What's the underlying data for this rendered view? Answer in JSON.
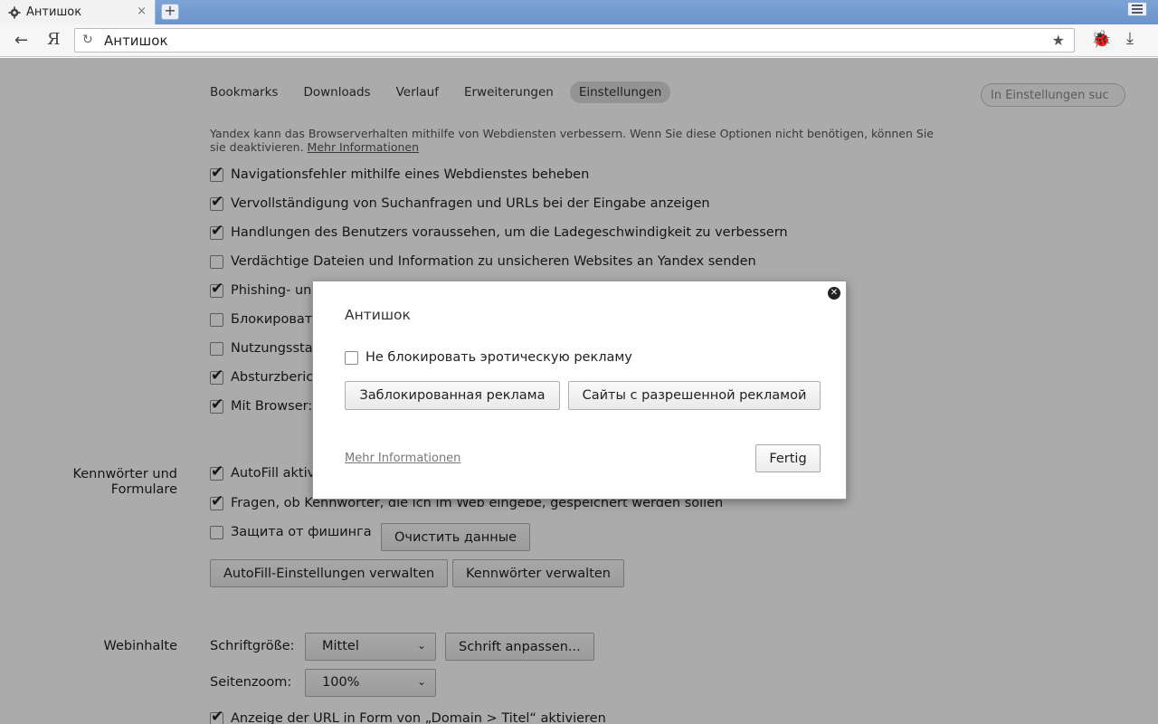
{
  "browser": {
    "tab_title": "Антишок",
    "tab_close": "×",
    "new_tab": "+",
    "back_icon": "←",
    "yandex_logo": "Я",
    "reload_icon": "↻",
    "address": "Антишок",
    "star_icon": "★",
    "bug_icon": "🐞",
    "download_icon": "⤓"
  },
  "nav": {
    "items": [
      {
        "label": "Bookmarks"
      },
      {
        "label": "Downloads"
      },
      {
        "label": "Verlauf"
      },
      {
        "label": "Erweiterungen"
      },
      {
        "label": "Einstellungen",
        "active": true
      }
    ],
    "search_placeholder": "In Einstellungen suc"
  },
  "privacy": {
    "intro": "Yandex kann das Browserverhalten mithilfe von Webdiensten verbessern. Wenn Sie diese Optionen nicht benötigen, können Sie sie deaktivieren.",
    "intro_link": "Mehr Informationen",
    "options": [
      {
        "label": "Navigationsfehler mithilfe eines Webdienstes beheben",
        "checked": true
      },
      {
        "label": "Vervollständigung von Suchanfragen und URLs bei der Eingabe anzeigen",
        "checked": true
      },
      {
        "label": "Handlungen des Benutzers voraussehen, um die Ladegeschwindigkeit zu verbessern",
        "checked": true
      },
      {
        "label": "Verdächtige Dateien und Information zu unsicheren Websites an Yandex senden",
        "checked": false
      },
      {
        "label": "Phishing- und",
        "checked": true
      },
      {
        "label": "Блокироват",
        "checked": false
      },
      {
        "label": "Nutzungssta",
        "checked": false
      },
      {
        "label": "Absturzberic",
        "checked": true
      },
      {
        "label": "Mit Browser:",
        "checked": true
      }
    ]
  },
  "passwords": {
    "section_label": "Kennwörter und Formulare",
    "autofill": {
      "label": "AutoFill aktiv",
      "checked": true
    },
    "ask_save": {
      "label": "Fragen, ob Kennwörter, die ich im Web eingebe, gespeichert werden sollen",
      "checked": true
    },
    "phishing": {
      "label": "Защита от фишинга",
      "checked": false
    },
    "clear_button": "Очистить данные",
    "autofill_settings_button": "AutoFill-Einstellungen verwalten",
    "manage_passwords_button": "Kennwörter verwalten"
  },
  "webcontent": {
    "section_label": "Webinhalte",
    "font_size_label": "Schriftgröße:",
    "font_size_value": "Mittel",
    "customize_fonts_button": "Schrift anpassen...",
    "zoom_label": "Seitenzoom:",
    "zoom_value": "100%",
    "url_format": {
      "label": "Anzeige der URL in Form von „Domain > Titel“ aktivieren",
      "checked": true
    }
  },
  "dialog": {
    "title": "Антишок",
    "checkbox_label": "Не блокировать эротическую рекламу",
    "checkbox_checked": false,
    "blocked_ads_button": "Заблокированная реклама",
    "allowed_sites_button": "Сайты с разрешенной рекламой",
    "more_info_link": "Mehr Informationen",
    "done_button": "Fertig",
    "close_icon": "✕"
  }
}
